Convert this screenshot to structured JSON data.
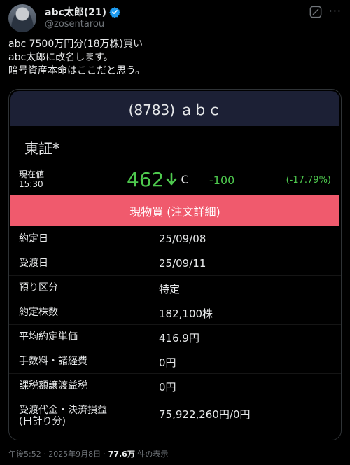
{
  "author": {
    "display_name": "abc太郎(21)",
    "handle": "@zosentarou",
    "verified_icon": "verified-badge-icon"
  },
  "tweet": {
    "lines": [
      "abc 7500万円分(18万株)買い",
      "abc太郎に改名します。",
      "暗号資産本命はここだと思う。"
    ]
  },
  "card": {
    "title": "(8783) ａｂｃ",
    "market": "東証*",
    "price_label_1": "現在値",
    "price_label_2": "15:30",
    "price": "462",
    "price_mark": "C",
    "change": "-100",
    "change_pct": "(-17.79%)",
    "order_label": "現物買 (注文詳細)",
    "rows": [
      {
        "label": "約定日",
        "value": "25/09/08"
      },
      {
        "label": "受渡日",
        "value": "25/09/11"
      },
      {
        "label": "預り区分",
        "value": "特定"
      },
      {
        "label": "約定株数",
        "value": "182,100株"
      },
      {
        "label": "平均約定単価",
        "value": "416.9円"
      },
      {
        "label": "手数料・諸経費",
        "value": "0円"
      },
      {
        "label": "課税額譲渡益税",
        "value": "0円"
      }
    ],
    "last_row": {
      "label_1": "受渡代金・決済損益",
      "label_2": "(日計り分)",
      "value": "75,922,260円/0円"
    }
  },
  "meta": {
    "time": "午後5:52 · 2025年9月8日 · ",
    "views": "77.6万",
    "views_suffix": " 件の表示"
  },
  "colors": {
    "background": "#000000",
    "card_header": "#1c2035",
    "accent_green": "#4ec94e",
    "order_button": "#f05a6d",
    "verified_blue": "#1d9bf0",
    "secondary_text": "#71767b"
  }
}
